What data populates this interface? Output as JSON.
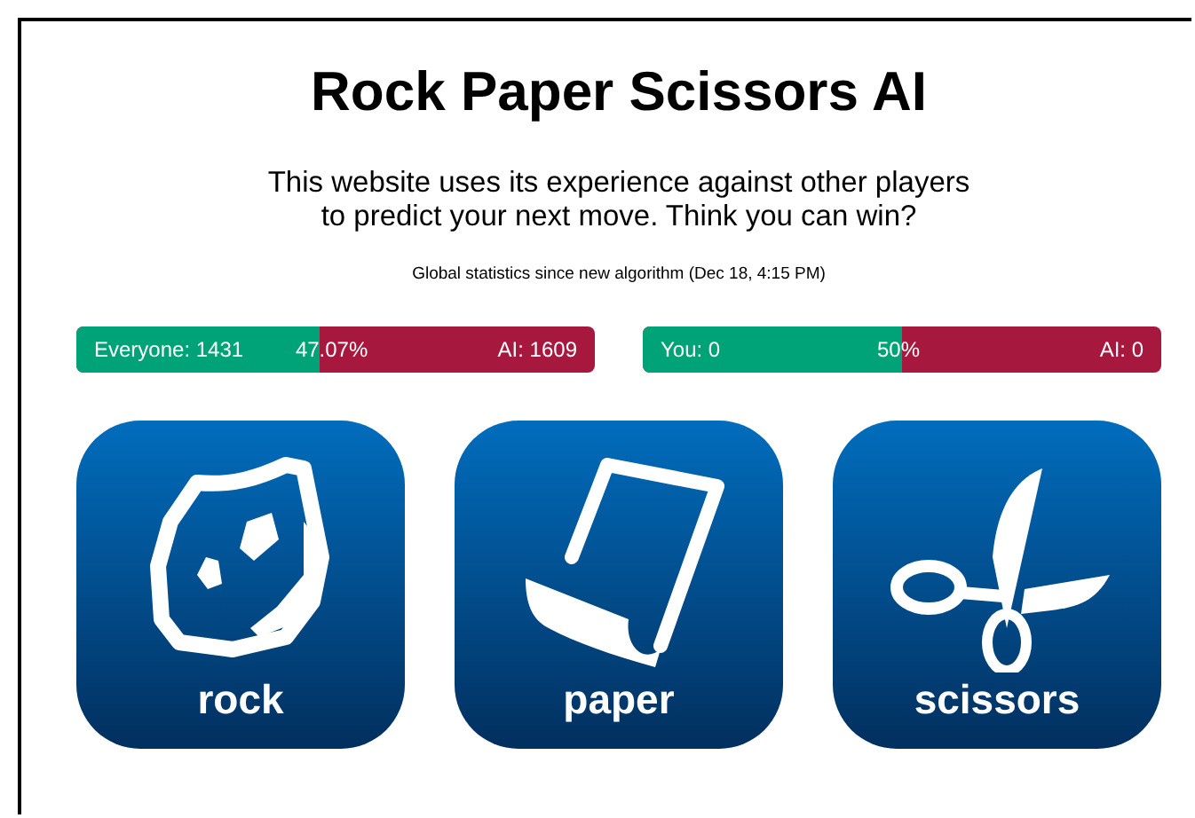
{
  "title": "Rock Paper Scissors AI",
  "intro": "This website uses its experience against other players to predict your next move. Think you can win?",
  "stats_caption": "Global statistics since new algorithm (Dec 18, 4:15 PM)",
  "score_bars": [
    {
      "left_label": "Everyone: 1431",
      "percent": "47.07%",
      "right_label": "AI: 1609",
      "level": 0.4707
    },
    {
      "left_label": "You: 0",
      "percent": "50%",
      "right_label": "AI: 0",
      "level": 0.5
    }
  ],
  "moves": [
    {
      "kind": "rock",
      "label": "rock"
    },
    {
      "kind": "paper",
      "label": "paper"
    },
    {
      "kind": "scissors",
      "label": "scissors"
    }
  ]
}
